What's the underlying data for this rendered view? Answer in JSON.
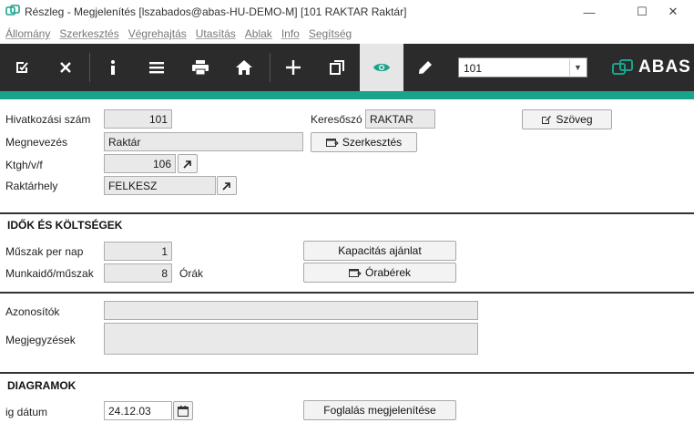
{
  "window": {
    "title": "Részleg - Megjelenítés  [lszabados@abas-HU-DEMO-M]  [101   RAKTAR  Raktár]",
    "controls": {
      "minimize": "—",
      "maximize": "☐",
      "close": "✕"
    }
  },
  "menu": [
    "Állomány",
    "Szerkesztés",
    "Végrehajtás",
    "Utasítás",
    "Ablak",
    "Info",
    "Segítség"
  ],
  "toolbar": {
    "combo_value": "101",
    "logo_text": "ABAS",
    "accent_color": "#18a48c"
  },
  "form": {
    "hivatkozasi_label": "Hivatkozási szám",
    "hivatkozasi_value": "101",
    "keresoszo_label": "Keresőszó",
    "keresoszo_value": "RAKTAR",
    "szoveg_button": "Szöveg",
    "megnevezes_label": "Megnevezés",
    "megnevezes_value": "Raktár",
    "szerkesztes_button": "Szerkesztés",
    "ktgh_label": "Ktgh/v/f",
    "ktgh_value": "106",
    "raktarhely_label": "Raktárhely",
    "raktarhely_value": "FELKESZ"
  },
  "idok": {
    "heading": "IDŐK ÉS KÖLTSÉGEK",
    "muszak_label": "Műszak per nap",
    "muszak_value": "1",
    "kapacitas_button": "Kapacitás ajánlat",
    "munkaido_label": "Munkaidő/műszak",
    "munkaido_value": "8",
    "munkaido_unit": "Órák",
    "orabérek_button": "Órabérek"
  },
  "misc": {
    "azonositok_label": "Azonosítók",
    "azonositok_value": "",
    "megjegyzesek_label": "Megjegyzések",
    "megjegyzesek_value": ""
  },
  "diagramok": {
    "heading": "DIAGRAMOK",
    "datum_label": "ig  dátum",
    "datum_value": "24.12.03",
    "foglalas_button": "Foglalás megjelenítése"
  }
}
